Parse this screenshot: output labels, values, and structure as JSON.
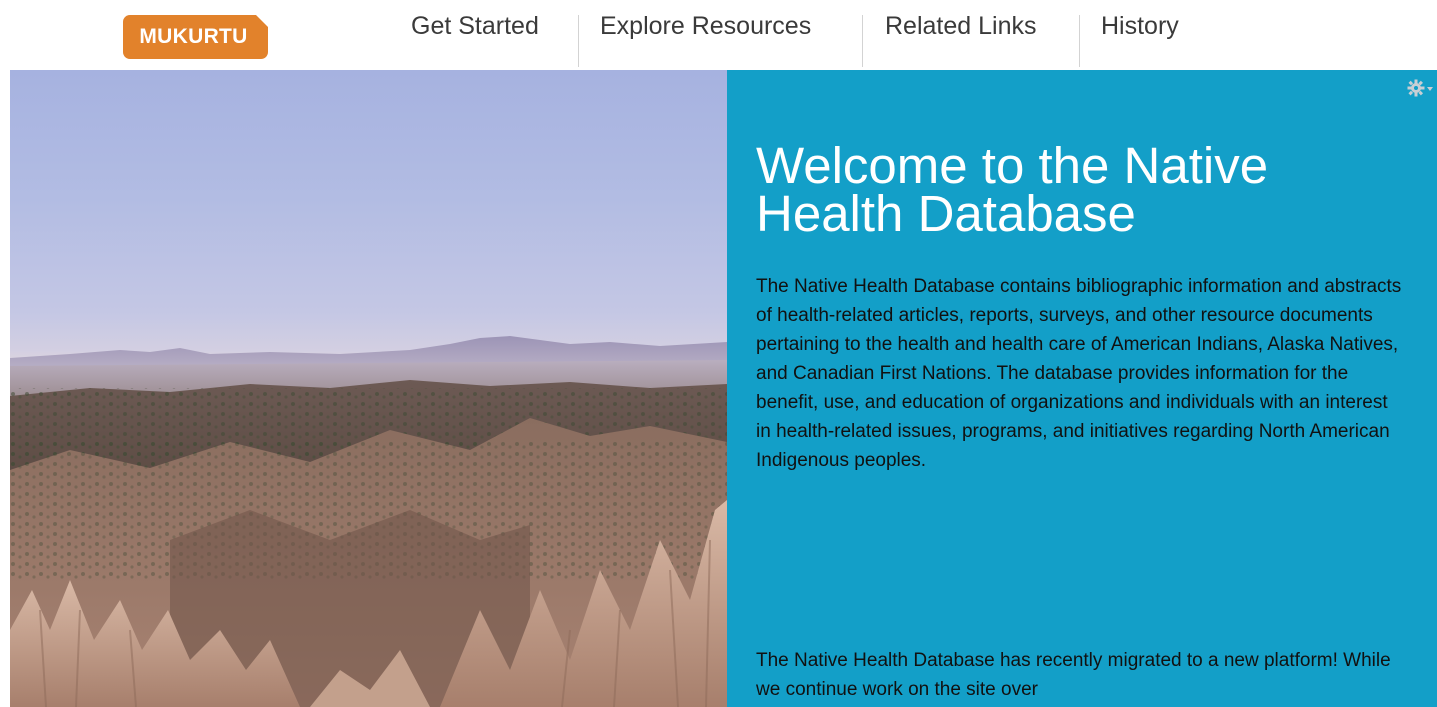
{
  "header": {
    "logo_text": "MUKURTU",
    "nav": [
      {
        "label": "Get Started"
      },
      {
        "label": "Explore Resources"
      },
      {
        "label": "Related Links"
      },
      {
        "label": "History"
      }
    ]
  },
  "hero": {
    "image_description": "desert canyon landscape with tent rock formations",
    "icon": "landscape-image"
  },
  "panel": {
    "background": "#139fc8",
    "title": "Welcome to the Native Health Database",
    "paragraph1": "The Native Health Database contains bibliographic information and abstracts of health-related articles, reports, surveys, and other resource documents pertaining to the health and health care of American Indians, Alaska Natives, and Canadian First Nations. The database provides information for the benefit, use, and education of organizations and individuals with an interest in health-related issues, programs, and initiatives regarding North American Indigenous peoples.",
    "paragraph2": "The Native Health Database has recently migrated to a new platform! While we continue work on the site over",
    "settings_icon": "gear-icon"
  },
  "colors": {
    "logo": "#e2822b",
    "accent_panel": "#139fc8"
  }
}
